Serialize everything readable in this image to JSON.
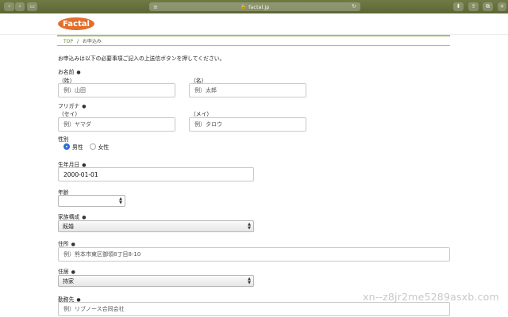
{
  "browser": {
    "url": "factal.jp",
    "back_glyph": "‹",
    "forward_glyph": "›",
    "sidebar_glyph": "▭",
    "reader_glyph": "≡",
    "lock_glyph": "🔒",
    "reload_glyph": "↻",
    "download_glyph": "⬇",
    "share_glyph": "⇪",
    "tabs_glyph": "⧉",
    "newtab_glyph": "+"
  },
  "site": {
    "logo": "Factal"
  },
  "breadcrumb": {
    "home": "TOP",
    "sep": "/",
    "current": "お申込み"
  },
  "intro": "お申込みは以下の必要事項ご記入の上送信ボタンを押してください。",
  "required_mark": "●",
  "form": {
    "name": {
      "label": "お名前",
      "last_label": "（姓）",
      "first_label": "（名）",
      "last_placeholder": "例）山田",
      "first_placeholder": "例）太郎"
    },
    "kana": {
      "label": "フリガナ",
      "last_label": "（セイ）",
      "first_label": "（メイ）",
      "last_placeholder": "例）ヤマダ",
      "first_placeholder": "例）タロウ"
    },
    "gender": {
      "label": "性別",
      "options": [
        "男性",
        "女性"
      ],
      "selected": "男性"
    },
    "birthday": {
      "label": "生年月日",
      "value": "2000-01-01"
    },
    "age": {
      "label": "年齢",
      "value": ""
    },
    "family": {
      "label": "家族構成",
      "value": "既婚"
    },
    "address": {
      "label": "住所",
      "placeholder": "例）熊本市東区御領8丁目8-10"
    },
    "housing": {
      "label": "住居",
      "value": "持家"
    },
    "workplace": {
      "label": "勤務先",
      "placeholder": "例）リブノース合同会社"
    }
  },
  "watermark": "xn--z8jr2me5289asxb.com"
}
